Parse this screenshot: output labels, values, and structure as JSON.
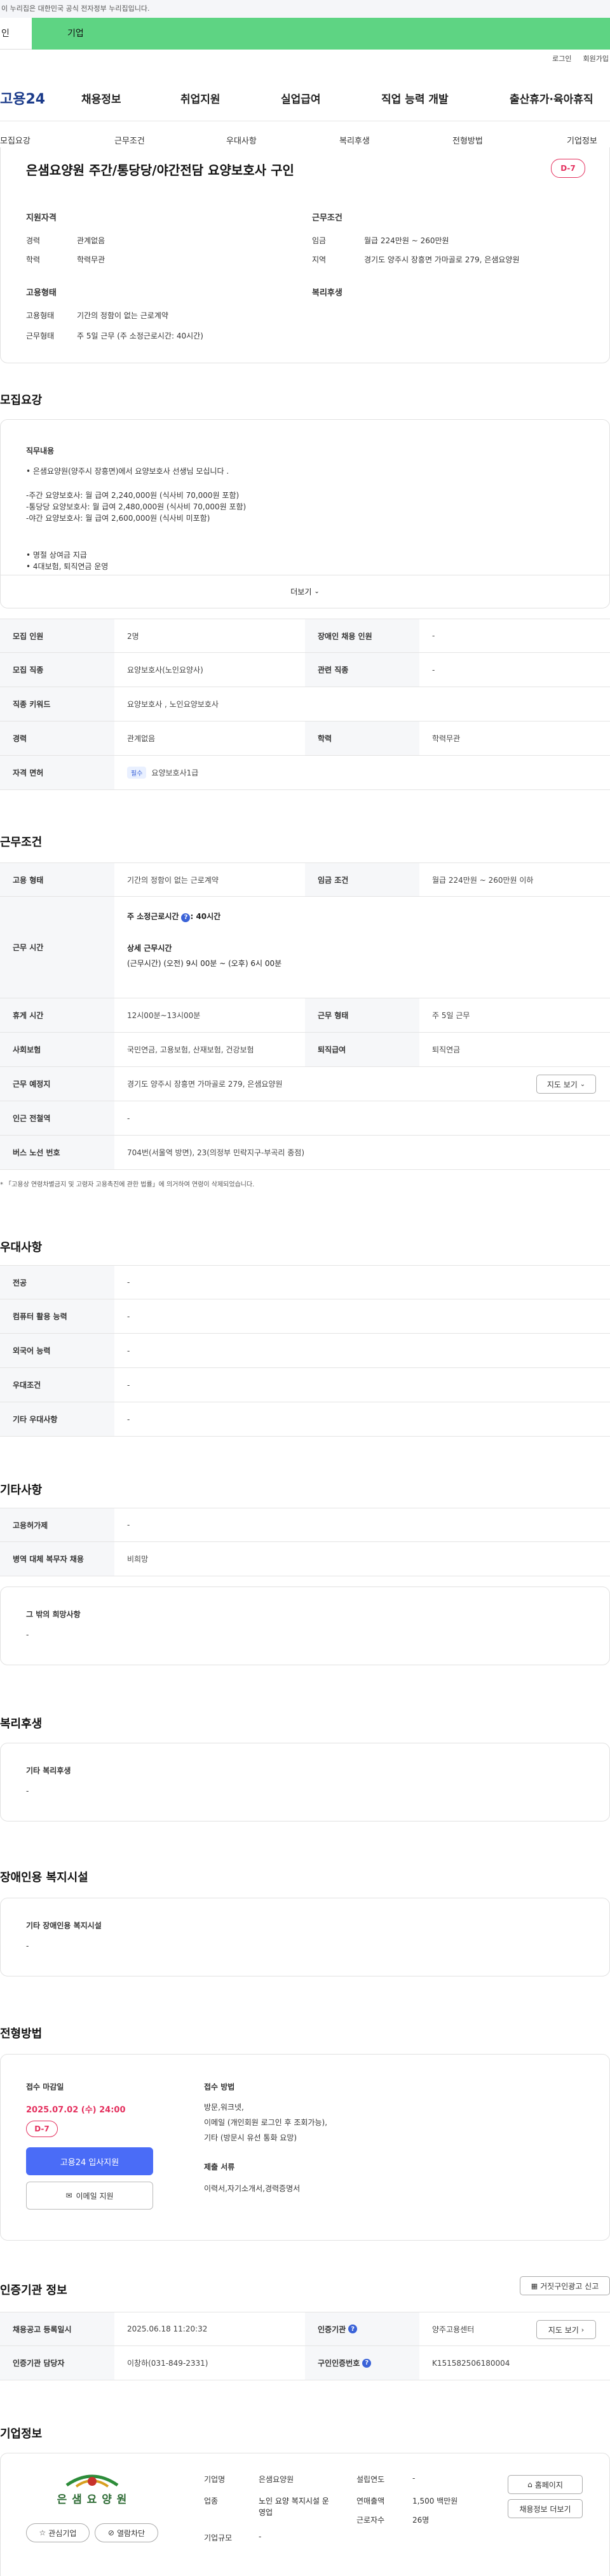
{
  "gov_banner": "이 누리집은 대한민국 공식 전자정부 누리집입니다.",
  "tabs": [
    "인",
    "기업"
  ],
  "util": [
    "로그인",
    "회원가입"
  ],
  "logo": "고용24",
  "gnb": [
    "채용정보",
    "취업지원",
    "실업급여",
    "직업 능력 개발",
    "출산휴가·육아휴직"
  ],
  "subnav": [
    "모집요강",
    "근무조건",
    "우대사항",
    "복리후생",
    "전형방법",
    "기업정보"
  ],
  "summary": {
    "title": "은샘요양원 주간/통당당/야간전담 요양보호사 구인",
    "dday": "D-7",
    "qual_head": "지원자격",
    "career_label": "경력",
    "career_value": "관계없음",
    "edu_label": "학력",
    "edu_value": "학력무관",
    "cond_head": "근무조건",
    "wage_label": "임금",
    "wage_value": "월급 224만원 ~ 260만원",
    "region_label": "지역",
    "region_value": "경기도 양주시 장흥면 가마골로 279, 은샘요양원",
    "emp_head": "고용형태",
    "emp_type_label": "고용형태",
    "emp_type_value": "기간의 정함이 없는 근로계약",
    "work_type_label": "근무형태",
    "work_type_value": "주 5일 근무 (주 소정근로시간: 40시간)",
    "welfare_head": "복리후생"
  },
  "recruit": {
    "heading": "모집요강",
    "job_head": "직무내용",
    "lines": [
      "• 은샘요양원(양주시 장흥면)에서 요양보호사 선생님 모십니다 .",
      "",
      "-주간 요양보호사: 월 급여 2,240,000원 (식사비 70,000원 포함)",
      "-통당당 요양보호사: 월 급여 2,480,000원 (식사비 70,000원 포함)",
      "-야간 요양보호사: 월 급여 2,600,000원 (식사비 미포함)",
      "",
      "• 명절 상여금 지급",
      "• 4대보험, 퇴직연금 운영"
    ],
    "more": "더보기",
    "rows": [
      {
        "l1": "모집 인원",
        "v1": "2명",
        "l2": "장애인 채용 인원",
        "v2": "-"
      },
      {
        "l1": "모집 직종",
        "v1": "요양보호사(노인요양사)",
        "l2": "관련 직종",
        "v2": "-"
      },
      {
        "l1": "직종 키워드",
        "v1": "요양보호사 , 노인요양보호사"
      },
      {
        "l1": "경력",
        "v1": "관계없음",
        "l2": "학력",
        "v2": "학력무관"
      },
      {
        "l1": "자격 면허",
        "badge": "필수",
        "v1": "요양보호사1급"
      }
    ]
  },
  "work": {
    "heading": "근무조건",
    "emp_label": "고용 형태",
    "emp_value": "기간의 정함이 없는 근로계약",
    "wage_label": "임금 조건",
    "wage_value": "월급 224만원 ~ 260만원 이하",
    "time_label": "근무 시간",
    "time_week": "주 소정근로시간",
    "time_week_val": ": 40시간",
    "time_detail_head": "상세 근무시간",
    "time_detail": "(근무시간) (오전) 9시 00분 ~ (오후) 6시 00분",
    "break_label": "휴게 시간",
    "break_value": "12시00분~13시00분",
    "form_label": "근무 형태",
    "form_value": "주 5일 근무",
    "ins_label": "사회보험",
    "ins_value": "국민연금, 고용보험, 산재보험, 건강보험",
    "ret_label": "퇴직급여",
    "ret_value": "퇴직연금",
    "place_label": "근무 예정지",
    "place_value": "경기도 양주시 장흥면 가마골로 279, 은샘요양원",
    "map_btn": "지도 보기",
    "station_label": "인근 전철역",
    "station_value": "-",
    "bus_label": "버스 노선 번호",
    "bus_value": "704번(서울역 방면), 23(의정부 민락지구-부곡리 종점)",
    "note": "* 「고용상 연령차별금지 및 고령자 고용촉진에 관한 법률」에 의거하여 연령이 삭제되었습니다."
  },
  "pref": {
    "heading": "우대사항",
    "rows": [
      {
        "l": "전공",
        "v": "-"
      },
      {
        "l": "컴퓨터 활용 능력",
        "v": "-"
      },
      {
        "l": "외국어 능력",
        "v": "-"
      },
      {
        "l": "우대조건",
        "v": "-"
      },
      {
        "l": "기타 우대사항",
        "v": "-"
      }
    ]
  },
  "etc": {
    "heading": "기타사항",
    "rows": [
      {
        "l": "고용허가제",
        "v": "-"
      },
      {
        "l": "병역 대체 복무자 채용",
        "v": "비희망"
      }
    ],
    "other_head": "그 밖의 희망사항",
    "other_value": "-"
  },
  "welfare": {
    "heading": "복리후생",
    "head": "기타 복리후생",
    "value": "-"
  },
  "disability": {
    "heading": "장애인용 복지시설",
    "head": "기타 장애인용 복지시설",
    "value": "-"
  },
  "process": {
    "heading": "전형방법",
    "deadline_head": "접수 마감일",
    "deadline": "2025.07.02 (수) 24:00",
    "dday": "D-7",
    "apply_btn": "고용24 입사지원",
    "email_btn": "이메일 지원",
    "method_head": "접수 방법",
    "methods": [
      "방문,워크넷,",
      "이메일 (개인회원 로그인 후 조회가능),",
      "기타 (방문시 유선 통화 요망)"
    ],
    "docs_head": "제출 서류",
    "docs": "이력서,자기소개서,경력증명서"
  },
  "cert": {
    "heading": "인증기관 정보",
    "report_btn": "거짓구인광고 신고",
    "reg_label": "채용공고 등록일시",
    "reg_value": "2025.06.18 11:20:32",
    "org_label": "인증기관",
    "org_value": "양주고용센터",
    "map_btn": "지도 보기",
    "mgr_label": "인증기관 담당자",
    "mgr_value": "이창하(031-849-2331)",
    "num_label": "구인인증번호",
    "num_value": "K151582506180004"
  },
  "company": {
    "heading": "기업정보",
    "logo_text": "은 샘 요 양 원",
    "fav_btn": "관심기업",
    "block_btn": "열람차단",
    "name_label": "기업명",
    "name_value": "은샘요양원",
    "ind_label": "업종",
    "ind_value": "노인 요양 복지시설 운영업",
    "scale_label": "기업규모",
    "scale_value": "-",
    "est_label": "설립연도",
    "est_value": "-",
    "sales_label": "연매출액",
    "sales_value": "1,500 백만원",
    "emp_label": "근로자수",
    "emp_value": "26명",
    "home_btn": "홈페이지",
    "info_btn": "채용정보 더보기"
  },
  "colors": {
    "accent": "#4a6cf7",
    "dday": "#e4305e",
    "tab_green": "#5ed483"
  }
}
